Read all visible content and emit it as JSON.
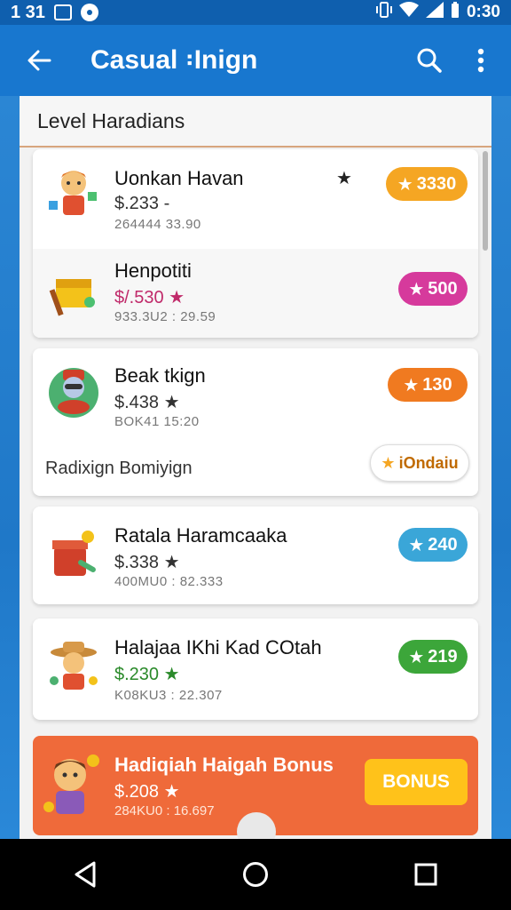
{
  "status_bar": {
    "time_left": "1 31",
    "time_right": "0:30"
  },
  "app_bar": {
    "title": "Casual ꞉Inign"
  },
  "section": {
    "title": "Level Haradians"
  },
  "items": [
    {
      "name": "Uonkan Havan",
      "price": "$.233 -",
      "sub": "264444 33.90",
      "badge": "3330",
      "badge_color": "#f5a623"
    },
    {
      "name": "Henpotiti",
      "price": "$/.530 ★",
      "sub": "933.3U2 : 29.59",
      "badge": "500",
      "badge_color": "#d63a9c"
    },
    {
      "name": "Beak tkign",
      "price": "$.438 ★",
      "sub": "BOK41 15:20",
      "badge": "130",
      "badge_color": "#f07a20"
    },
    {
      "name": "Ratala Haramcaaka",
      "price": "$.338 ★",
      "sub": "400MU0 : 82.333",
      "badge": "240",
      "badge_color": "#3aa6d8"
    },
    {
      "name": "Halajaa IKhi Kad COtah",
      "price": "$.230 ★",
      "sub": "K08KU3 : 22.307",
      "badge": "219",
      "badge_color": "#3ca63a"
    }
  ],
  "extra_row": {
    "label": "Radixign Bomiyign",
    "button": "iOndaiu"
  },
  "bonus": {
    "name": "Hadiqiah Haigah Bonus",
    "price": "$.208 ★",
    "sub": "284KU0 : 16.697",
    "button": "BONUS"
  }
}
